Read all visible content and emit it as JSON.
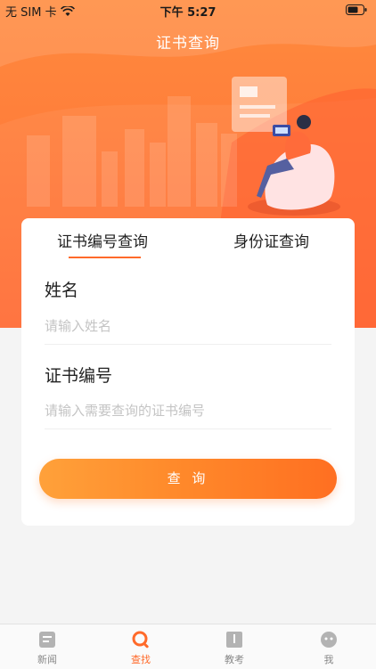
{
  "status_bar": {
    "carrier": "无 SIM 卡",
    "time": "下午 5:27"
  },
  "header": {
    "title": "证书查询"
  },
  "tabs": [
    {
      "label": "证书编号查询",
      "active": true
    },
    {
      "label": "身份证查询",
      "active": false
    }
  ],
  "form": {
    "name_label": "姓名",
    "name_placeholder": "请输入姓名",
    "cert_label": "证书编号",
    "cert_placeholder": "请输入需要查询的证书编号",
    "submit_label": "查 询"
  },
  "tabbar": [
    {
      "label": "新闻",
      "icon": "news-icon",
      "active": false
    },
    {
      "label": "查找",
      "icon": "search-icon",
      "active": true
    },
    {
      "label": "教考",
      "icon": "book-icon",
      "active": false
    },
    {
      "label": "我",
      "icon": "profile-icon",
      "active": false
    }
  ],
  "colors": {
    "accent": "#ff6a2a",
    "hero": "#ff7a3a"
  }
}
